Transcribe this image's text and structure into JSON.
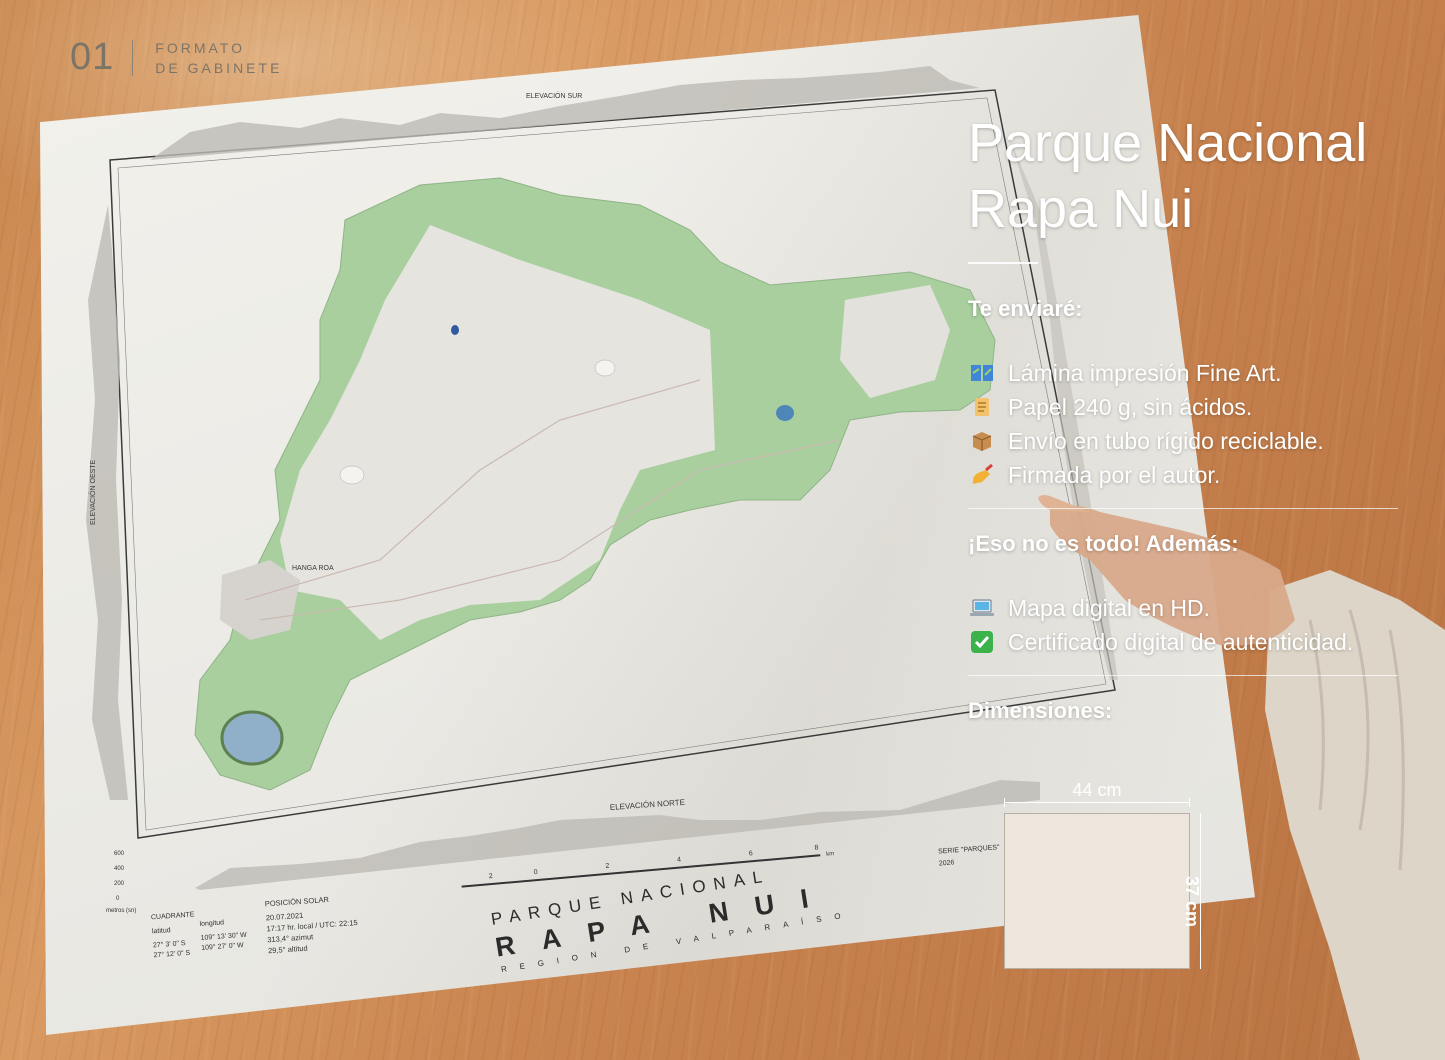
{
  "badge": {
    "number": "01",
    "line1": "FORMATO",
    "line2": "DE GABINETE"
  },
  "panel": {
    "title_line1": "Parque Nacional",
    "title_line2": "Rapa Nui",
    "section1": "Te enviaré:",
    "items1": [
      {
        "icon": "map-book-icon",
        "text": "Lámina impresión Fine Art."
      },
      {
        "icon": "scroll-icon",
        "text": "Papel 240 g, sin ácidos."
      },
      {
        "icon": "package-icon",
        "text": "Envío en tubo rígido reciclable."
      },
      {
        "icon": "writing-hand-icon",
        "text": "Firmada por el autor."
      }
    ],
    "section2": "¡Eso no es todo! Además:",
    "items2": [
      {
        "icon": "laptop-icon",
        "text": "Mapa digital en HD."
      },
      {
        "icon": "check-mark-icon",
        "text": "Certificado digital de autenticidad."
      }
    ],
    "section3": "Dimensiones:",
    "width": "44 cm",
    "height": "37 cm"
  },
  "map": {
    "title_top": "PARQUE NACIONAL",
    "title_main": "RAPA NUI",
    "title_sub": "REGION DE VALPARAÍSO",
    "elev_south": "ELEVACIÓN SUR",
    "elev_north": "ELEVACIÓN NORTE",
    "elev_west": "ELEVACIÓN OESTE",
    "town": "HANGA ROA",
    "quadrant_title": "CUADRANTE",
    "lat_label": "latitud",
    "lon_label": "longitud",
    "lat1": "27° 3' 0\" S",
    "lat2": "27° 12' 0\" S",
    "lon1": "109° 13' 30\" W",
    "lon2": "109° 27' 0\" W",
    "solar_title": "POSICIÓN SOLAR",
    "solar_date": "20.07.2021",
    "solar_time": "17:17 hr. local / UTC: 22:15",
    "solar_azimut": "313,4° azimut",
    "solar_alt": "29,5° altitud",
    "serie": "SERIE \"PARQUES\"",
    "year": "2026",
    "scale_unit": "km",
    "scale_ticks": [
      "2",
      "0",
      "2",
      "4",
      "6",
      "8"
    ],
    "elev_ticks": [
      "600",
      "400",
      "200",
      "0"
    ],
    "elev_unit": "metros (sn)"
  },
  "colors": {
    "green": "#a8cf9f",
    "land": "#e7e5e0",
    "sheet": "#efeee9",
    "text": "#3a3a3a"
  }
}
